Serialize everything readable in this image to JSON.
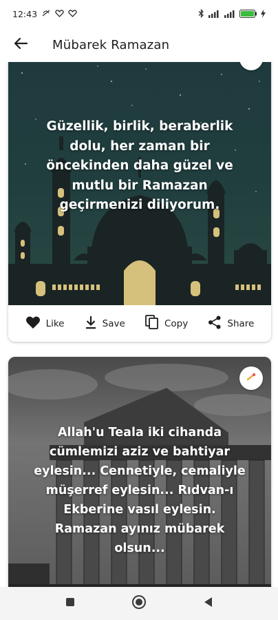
{
  "status_bar": {
    "time": "12:43",
    "battery_level": 1.0,
    "battery_color": "#3dbd3d"
  },
  "app_bar": {
    "title": "Mübarek Ramazan",
    "back_icon": "arrow-left-icon"
  },
  "cards": [
    {
      "quote": "Güzellik, birlik, beraberlik dolu, her zaman bir öncekinden daha güzel ve mutlu bir Ramazan geçirmenizi diliyorum.",
      "background": "night-mosque-crescent",
      "accent_color": "#d6c17c",
      "actions": [
        {
          "label": "Like",
          "icon": "heart-icon"
        },
        {
          "label": "Save",
          "icon": "download-icon"
        },
        {
          "label": "Copy",
          "icon": "copy-icon"
        },
        {
          "label": "Share",
          "icon": "share-icon"
        }
      ]
    },
    {
      "quote": "Allah'u Teala iki cihanda cümlemizi aziz ve bahtiyar eylesin... Cennetiyle, cemaliyle müşerref eylesin... Rıdvan-ı Ekberine vasıl eylesin. Ramazan ayınız mübarek olsun...",
      "background": "grayscale-ancient-temple"
    }
  ],
  "nav_bar": {
    "buttons": [
      "recents-square-icon",
      "home-circle-icon",
      "back-triangle-icon"
    ]
  }
}
